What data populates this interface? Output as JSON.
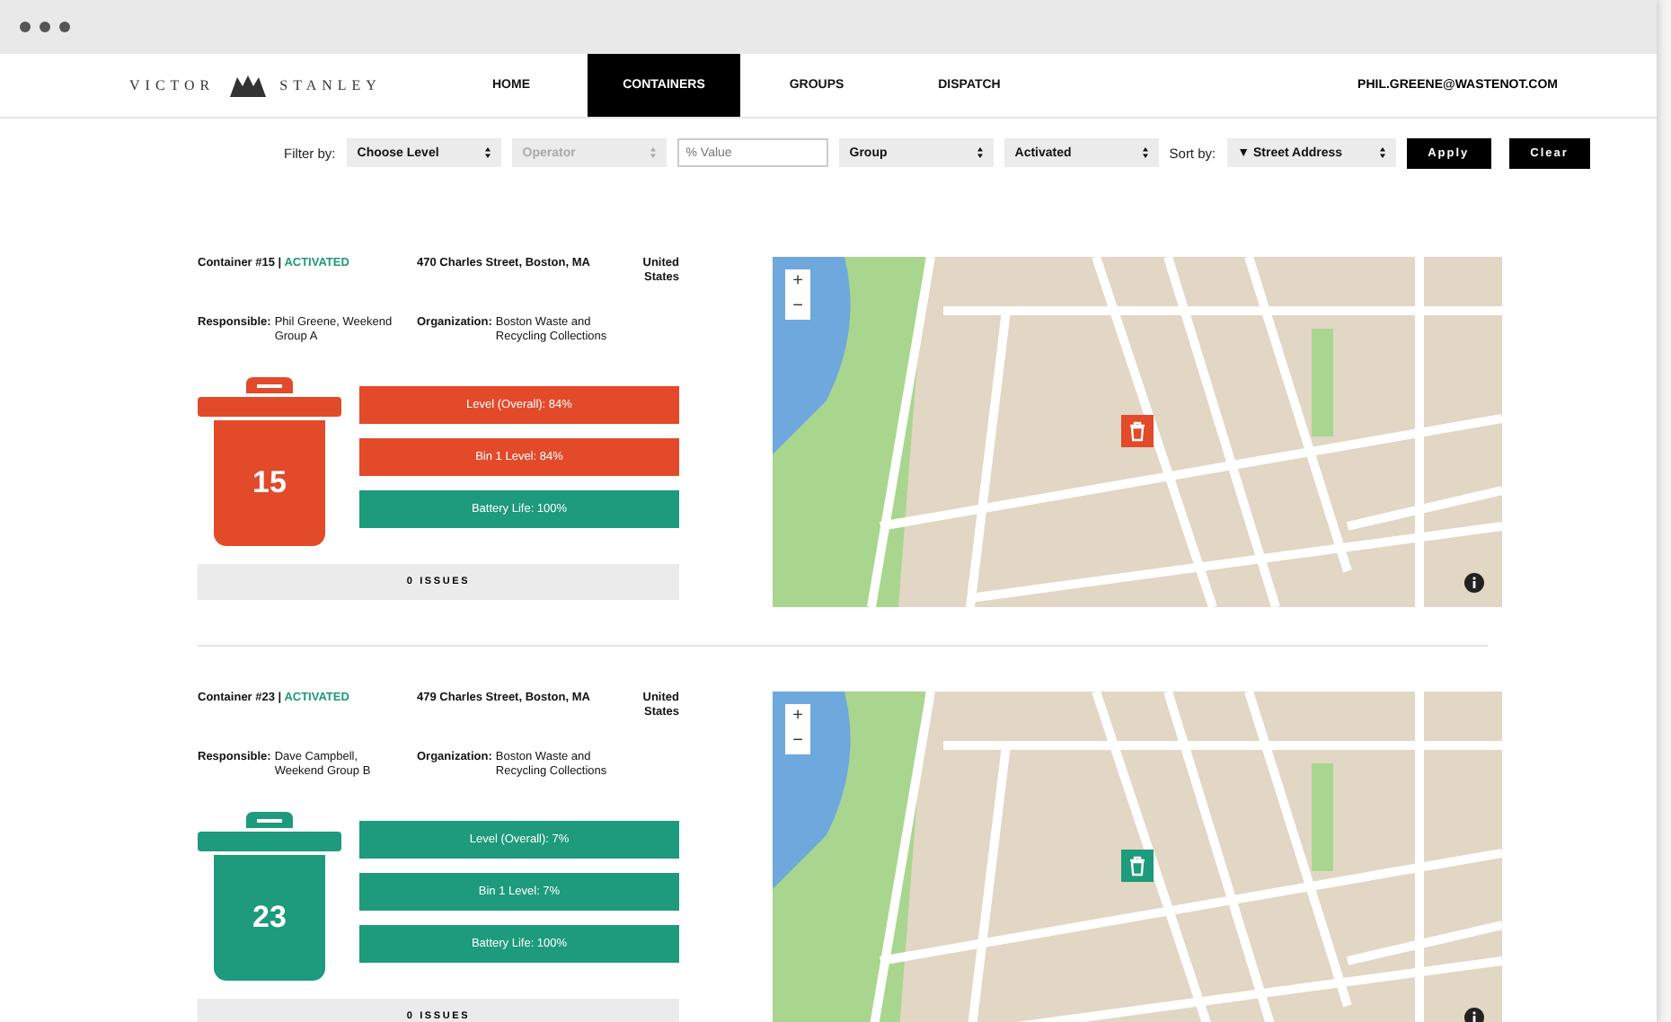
{
  "brand": "VICTOR STANLEY",
  "nav": [
    {
      "label": "HOME",
      "selected": false
    },
    {
      "label": "CONTAINERS",
      "selected": true
    },
    {
      "label": "GROUPS",
      "selected": false
    },
    {
      "label": "DISPATCH",
      "selected": false
    }
  ],
  "user": "PHIL.GREENE@WASTENOT.COM",
  "filter_label": "Filter by:",
  "filters": [
    {
      "kind": "select",
      "value": "Choose Level",
      "disabled": false
    },
    {
      "kind": "select",
      "value": "Operator",
      "disabled": true
    },
    {
      "kind": "input",
      "placeholder": "% Value"
    },
    {
      "kind": "select",
      "value": "Group",
      "disabled": false
    },
    {
      "kind": "select",
      "value": "Activated",
      "disabled": false
    }
  ],
  "sort_label": "Sort by:",
  "sort": {
    "value": "▼ Street Address"
  },
  "buttons": [
    "Apply",
    "Clear"
  ],
  "containers": [
    {
      "title": "Container #15",
      "separator": "|",
      "status": "ACTIVATED",
      "address": "470 Charles Street, Boston, MA",
      "country": "United States",
      "responsible_label": "Responsible:",
      "responsible": "Phil Greene, Weekend Group A",
      "organization_label": "Organization:",
      "organization": "Boston Waste and Recycling Collections",
      "number": "15",
      "color": "#e24a2a",
      "bars": [
        {
          "label": "Level (Overall): 84%",
          "color": "#e24a2a"
        },
        {
          "label": "Bin 1 Level: 84%",
          "color": "#e24a2a"
        },
        {
          "label": "Battery Life: 100%",
          "color": "#1e9a7c"
        }
      ],
      "issues": "0 ISSUES",
      "map": {
        "zoom_in": "+",
        "zoom_out": "−",
        "marker": {
          "color": "#e24a2a"
        }
      }
    },
    {
      "title": "Container #23",
      "separator": "|",
      "status": "ACTIVATED",
      "address": "479 Charles Street, Boston, MA",
      "country": "United States",
      "responsible_label": "Responsible:",
      "responsible": "Dave Campbell, Weekend Group B",
      "organization_label": "Organization:",
      "organization": "Boston Waste and Recycling Collections",
      "number": "23",
      "color": "#1e9a7c",
      "bars": [
        {
          "label": "Level (Overall): 7%",
          "color": "#1e9a7c"
        },
        {
          "label": "Bin 1 Level: 7%",
          "color": "#1e9a7c"
        },
        {
          "label": "Battery Life: 100%",
          "color": "#1e9a7c"
        }
      ],
      "issues": "0 ISSUES",
      "map": {
        "zoom_in": "+",
        "zoom_out": "−",
        "marker": {
          "color": "#1e9a7c"
        }
      }
    }
  ]
}
